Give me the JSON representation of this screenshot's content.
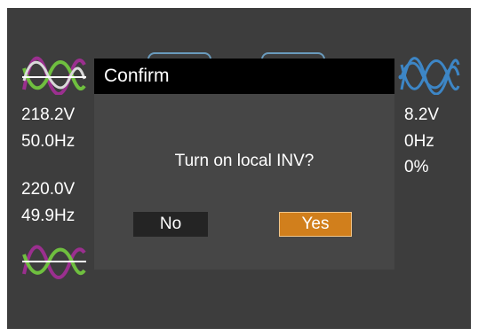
{
  "screen": {
    "left_panel": {
      "grid_voltage": "218.2V",
      "grid_frequency": "50.0Hz",
      "inv_voltage": "220.0V",
      "inv_frequency": "49.9Hz"
    },
    "right_panel": {
      "voltage_partial": "8.2V",
      "frequency_partial": "0Hz",
      "percent": "0%"
    },
    "icons": {
      "grid_wave": "three-phase-sine-wave-icon",
      "load_wave": "three-phase-sine-wave-icon",
      "inv_wave": "three-phase-sine-wave-icon"
    }
  },
  "dialog": {
    "title": "Confirm",
    "message": "Turn on local INV?",
    "no_label": "No",
    "yes_label": "Yes"
  },
  "colors": {
    "screen_bg": "#3d3d3d",
    "dialog_bg": "#464646",
    "title_bar": "#000000",
    "yes_button": "#d17f1c",
    "no_button": "#242424",
    "wave_purple": "#9b2f8f",
    "wave_green": "#6fbf3f",
    "wave_blue": "#3d86c6"
  }
}
